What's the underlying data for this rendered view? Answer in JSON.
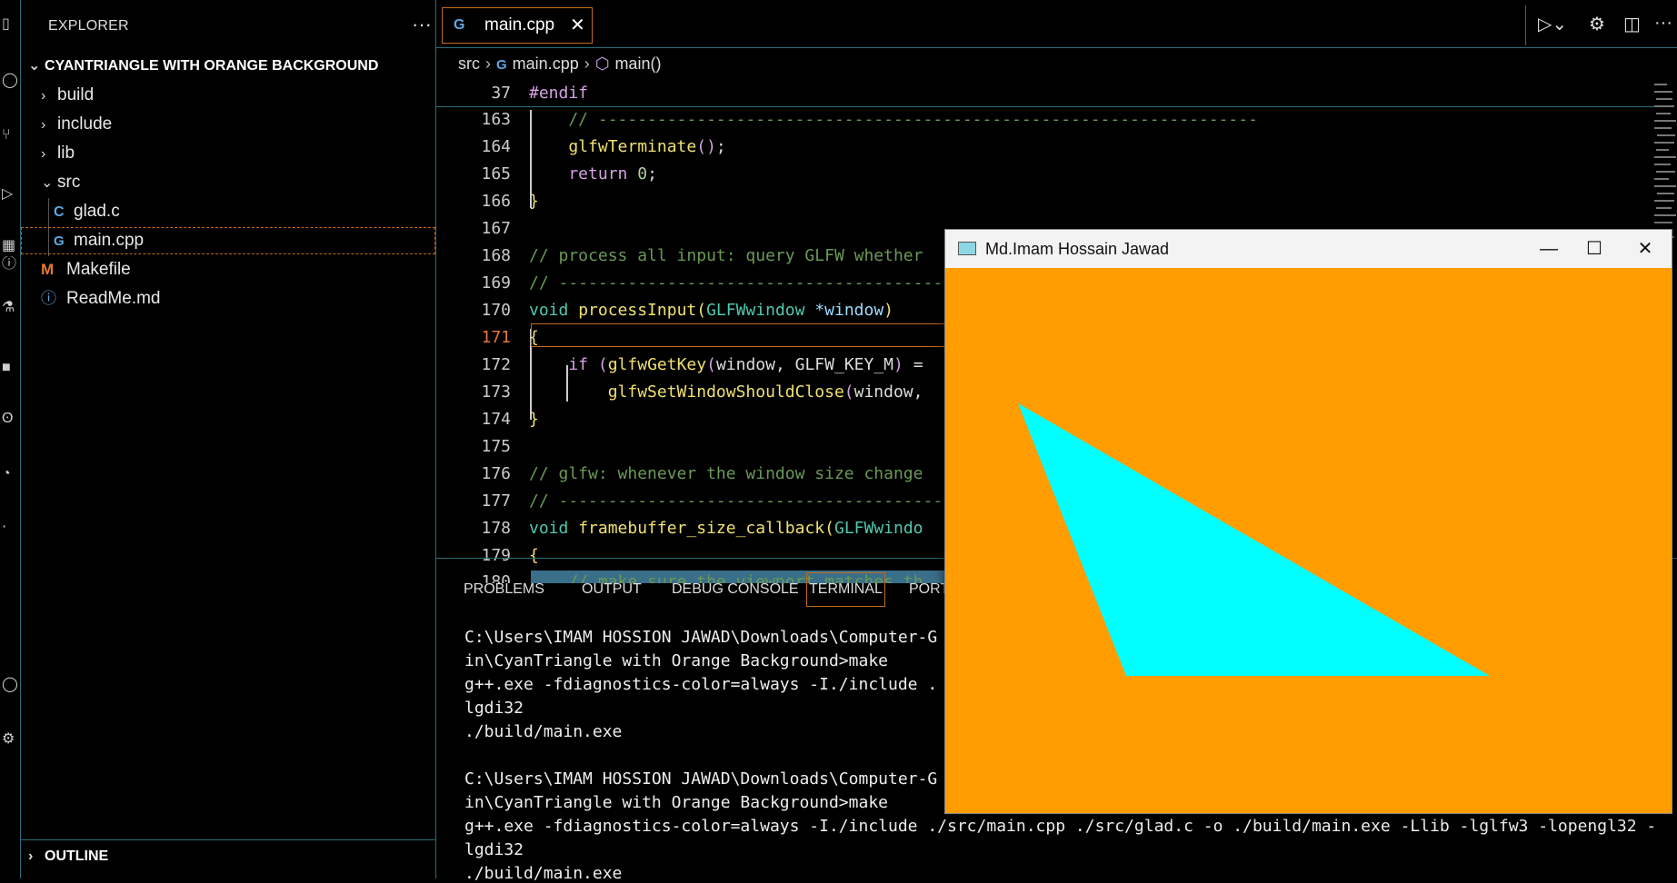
{
  "explorer": {
    "title": "EXPLORER",
    "more": "···",
    "project": "CYANTRIANGLE WITH ORANGE BACKGROUND",
    "items": [
      {
        "label": "build"
      },
      {
        "label": "include"
      },
      {
        "label": "lib"
      },
      {
        "label": "src"
      },
      {
        "label": "glad.c",
        "icon": "C"
      },
      {
        "label": "main.cpp",
        "icon": "G"
      },
      {
        "label": "Makefile",
        "icon": "M"
      },
      {
        "label": "ReadMe.md",
        "icon": "ⓘ"
      }
    ],
    "outline": "OUTLINE"
  },
  "editor": {
    "tab": {
      "label": "main.cpp",
      "icon": "G",
      "close": "✕"
    },
    "breadcrumb": {
      "folder": "src",
      "file": "main.cpp",
      "symbol": "main()"
    },
    "sticky": {
      "line": "37",
      "text": "#endif"
    },
    "lines": [
      {
        "n": "163",
        "text": "    // -------------------------------------------------------------------"
      },
      {
        "n": "164",
        "text": "    glfwTerminate();"
      },
      {
        "n": "165",
        "text": "    return 0;"
      },
      {
        "n": "166",
        "text": "}"
      },
      {
        "n": "167",
        "text": ""
      },
      {
        "n": "168",
        "text": "// process all input: query GLFW whether"
      },
      {
        "n": "169",
        "text": "// ---------------------------------------"
      },
      {
        "n": "170",
        "text": "void processInput(GLFWwindow *window)"
      },
      {
        "n": "171",
        "text": "{"
      },
      {
        "n": "172",
        "text": "    if (glfwGetKey(window, GLFW_KEY_M) ="
      },
      {
        "n": "173",
        "text": "        glfwSetWindowShouldClose(window,"
      },
      {
        "n": "174",
        "text": "}"
      },
      {
        "n": "175",
        "text": ""
      },
      {
        "n": "176",
        "text": "// glfw: whenever the window size change"
      },
      {
        "n": "177",
        "text": "// ---------------------------------------"
      },
      {
        "n": "178",
        "text": "void framebuffer_size_callback(GLFWwindo"
      },
      {
        "n": "179",
        "text": "{"
      },
      {
        "n": "180",
        "text": "    // make sure the viewport matches th"
      }
    ]
  },
  "panel": {
    "tabs": [
      "PROBLEMS",
      "OUTPUT",
      "DEBUG CONSOLE",
      "TERMINAL",
      "PORT"
    ],
    "terminal": [
      "C:\\Users\\IMAM HOSSION JAWAD\\Downloads\\Computer-G",
      "in\\CyanTriangle with Orange Background>make",
      "g++.exe -fdiagnostics-color=always -I./include .",
      "lgdi32",
      "./build/main.exe",
      "",
      "C:\\Users\\IMAM HOSSION JAWAD\\Downloads\\Computer-G",
      "in\\CyanTriangle with Orange Background>make",
      "g++.exe -fdiagnostics-color=always -I./include ./src/main.cpp ./src/glad.c -o ./build/main.exe -Llib -lglfw3 -lopengl32 -",
      "lgdi32",
      "./build/main.exe"
    ]
  },
  "glfw_window": {
    "title": "Md.Imam Hossain Jawad",
    "minimize": "—",
    "maximize": "☐",
    "close": "✕",
    "background_color": "#ff9d00",
    "triangle_color": "#00ffff"
  },
  "colors": {
    "accent_border": "#c26a1a",
    "divider": "#2a6f7a"
  }
}
